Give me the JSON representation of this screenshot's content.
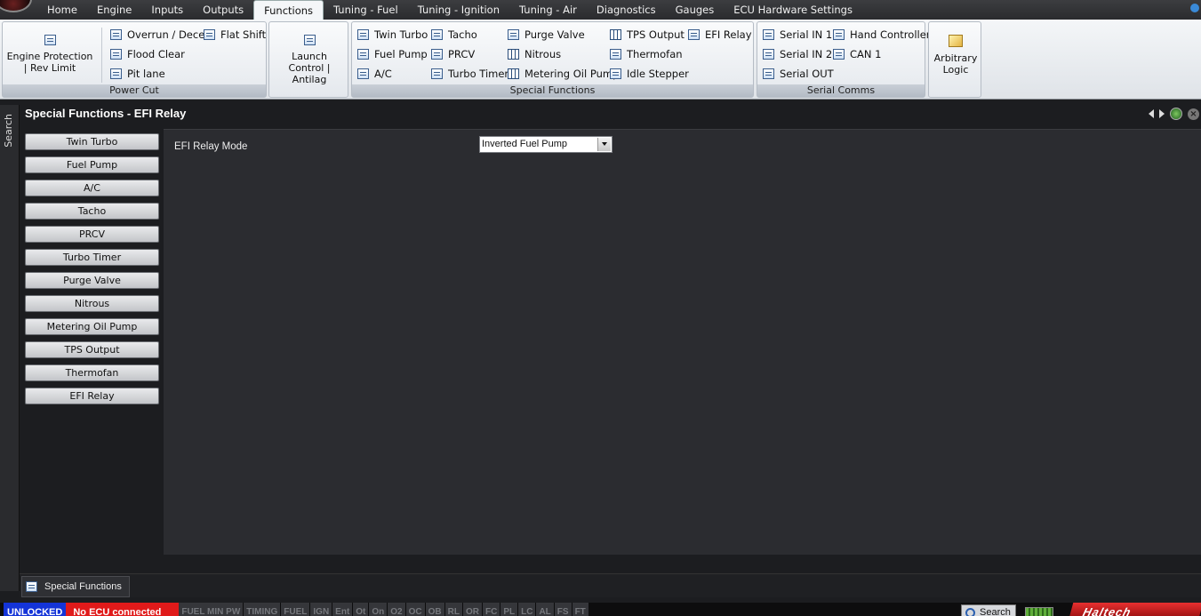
{
  "menu": {
    "tabs": [
      "Home",
      "Engine",
      "Inputs",
      "Outputs",
      "Functions",
      "Tuning - Fuel",
      "Tuning - Ignition",
      "Tuning - Air",
      "Diagnostics",
      "Gauges",
      "ECU Hardware Settings"
    ],
    "active_tab": "Functions"
  },
  "ribbon": {
    "power_cut": {
      "label": "Power Cut",
      "engine_protection": "Engine Protection | Rev Limit",
      "overrun": "Overrun / Decel",
      "flood_clear": "Flood Clear",
      "pit_lane": "Pit lane",
      "flat_shift": "Flat Shift"
    },
    "launch_control": "Launch Control | Antilag",
    "special_functions": {
      "label": "Special Functions",
      "twin_turbo": "Twin Turbo",
      "fuel_pump": "Fuel Pump",
      "ac": "A/C",
      "tacho": "Tacho",
      "prcv": "PRCV",
      "turbo_timer": "Turbo Timer",
      "purge_valve": "Purge Valve",
      "nitrous": "Nitrous",
      "metering_oil_pump": "Metering Oil Pump",
      "tps_output": "TPS Output",
      "thermofan": "Thermofan",
      "idle_stepper": "Idle Stepper",
      "efi_relay": "EFI Relay"
    },
    "serial_comms": {
      "label": "Serial Comms",
      "serial_in_1": "Serial IN 1",
      "serial_in_2": "Serial IN 2",
      "serial_out": "Serial OUT",
      "hand_controller": "Hand Controller",
      "can_1": "CAN 1"
    },
    "arbitrary_logic": "Arbitrary Logic"
  },
  "side": {
    "search_label": "Search"
  },
  "panel": {
    "title": "Special Functions - EFI Relay",
    "buttons": [
      "Twin Turbo",
      "Fuel Pump",
      "A/C",
      "Tacho",
      "PRCV",
      "Turbo Timer",
      "Purge Valve",
      "Nitrous",
      "Metering Oil Pump",
      "TPS Output",
      "Thermofan",
      "EFI Relay"
    ],
    "field_label": "EFI Relay Mode",
    "field_value": "Inverted Fuel Pump"
  },
  "bottom_tab": {
    "label": "Special Functions"
  },
  "status": {
    "unlocked": "UNLOCKED",
    "ecu": "No ECU connected",
    "cells": [
      "FUEL MIN PW",
      "TIMING",
      "FUEL",
      "IGN",
      "Ent",
      "Ot",
      "On",
      "O2",
      "OC",
      "OB",
      "RL",
      "OR",
      "FC",
      "PL",
      "LC",
      "AL",
      "FS",
      "FT"
    ],
    "search": "Search",
    "logo_text": "Haltech"
  },
  "colors": {
    "unlocked_bg": "#1434d8",
    "ecu_bg": "#e01a1a",
    "content_bg": "#2b2c30"
  }
}
